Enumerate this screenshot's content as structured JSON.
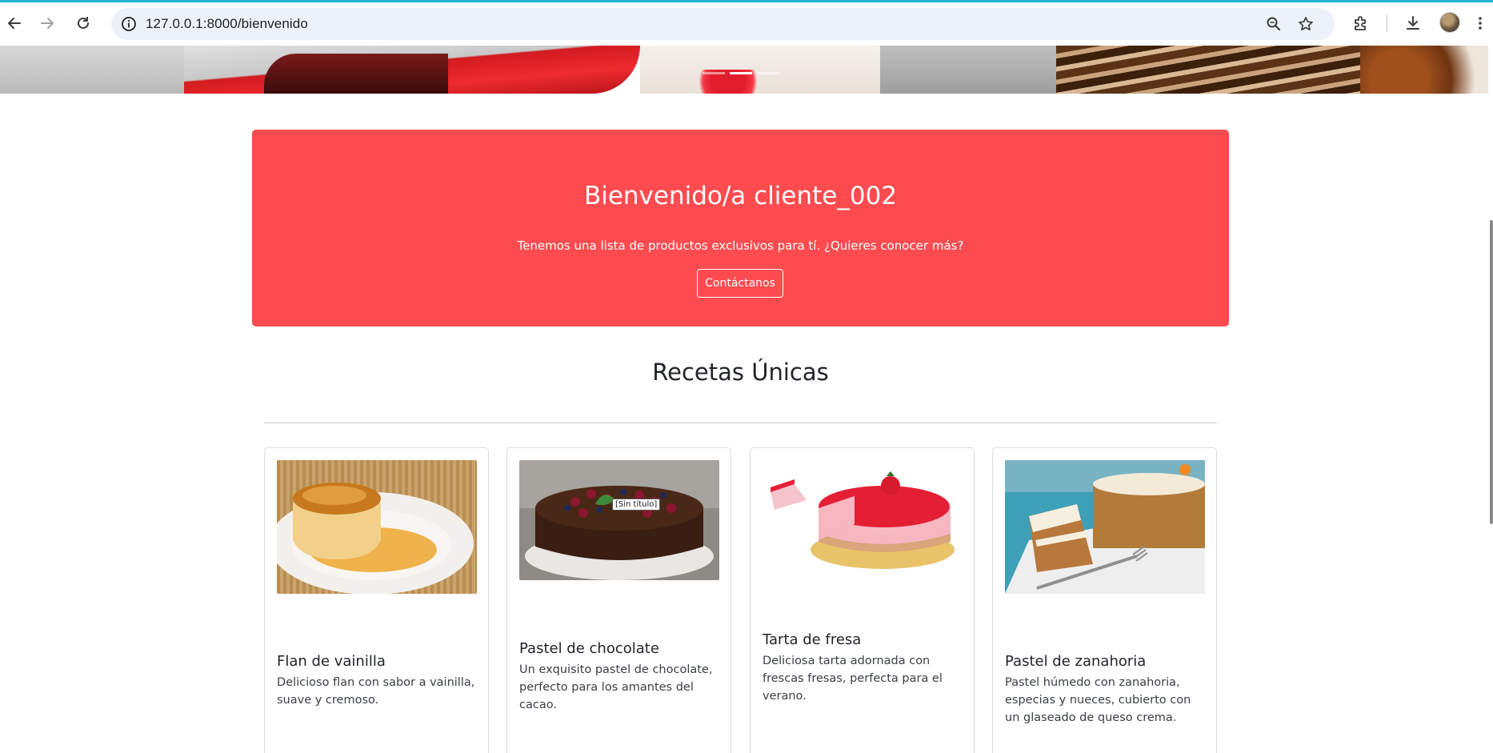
{
  "browser": {
    "url": "127.0.0.1:8000/bienvenido",
    "icons": [
      "back-icon",
      "forward-icon",
      "reload-icon",
      "site-info-icon",
      "zoom-icon",
      "bookmark-star-icon",
      "extensions-icon",
      "downloads-icon",
      "profile-avatar",
      "menu-kebab-icon"
    ]
  },
  "carousel": {
    "indicators": 3,
    "active_index": 1
  },
  "banner": {
    "title": "Bienvenido/a cliente_002",
    "text": "Tenemos una lista de productos exclusivos para tí. ¿Quieres conocer más?",
    "button": "Contáctanos",
    "color": "#fe4b4f"
  },
  "section": {
    "title": "Recetas Únicas"
  },
  "recipes": [
    {
      "title": "Flan de vainilla",
      "description": "Delicioso flan con sabor a vainilla, suave y cremoso."
    },
    {
      "title": "Pastel de chocolate",
      "description": "Un exquisito pastel de chocolate, perfecto para los amantes del cacao.",
      "tooltip": "[Sin título]"
    },
    {
      "title": "Tarta de fresa",
      "description": "Deliciosa tarta adornada con frescas fresas, perfecta para el verano."
    },
    {
      "title": "Pastel de zanahoria",
      "description": "Pastel húmedo con zanahoria, especias y nueces, cubierto con un glaseado de queso crema."
    }
  ]
}
